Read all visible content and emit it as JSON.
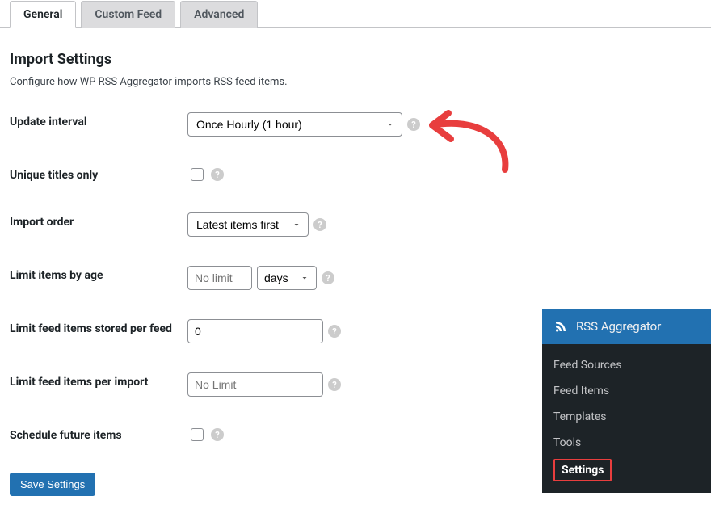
{
  "tabs": {
    "general": "General",
    "custom_feed": "Custom Feed",
    "advanced": "Advanced"
  },
  "section": {
    "title": "Import Settings",
    "description": "Configure how WP RSS Aggregator imports RSS feed items."
  },
  "form": {
    "update_interval": {
      "label": "Update interval",
      "value": "Once Hourly (1 hour)"
    },
    "unique_titles": {
      "label": "Unique titles only"
    },
    "import_order": {
      "label": "Import order",
      "value": "Latest items first"
    },
    "limit_age": {
      "label": "Limit items by age",
      "placeholder": "No limit",
      "unit": "days"
    },
    "limit_stored": {
      "label": "Limit feed items stored per feed",
      "value": "0"
    },
    "limit_per_import": {
      "label": "Limit feed items per import",
      "placeholder": "No Limit"
    },
    "schedule_future": {
      "label": "Schedule future items"
    },
    "save": "Save Settings"
  },
  "wp_sidebar": {
    "title": "RSS Aggregator",
    "items": [
      "Feed Sources",
      "Feed Items",
      "Templates",
      "Tools",
      "Settings"
    ]
  }
}
